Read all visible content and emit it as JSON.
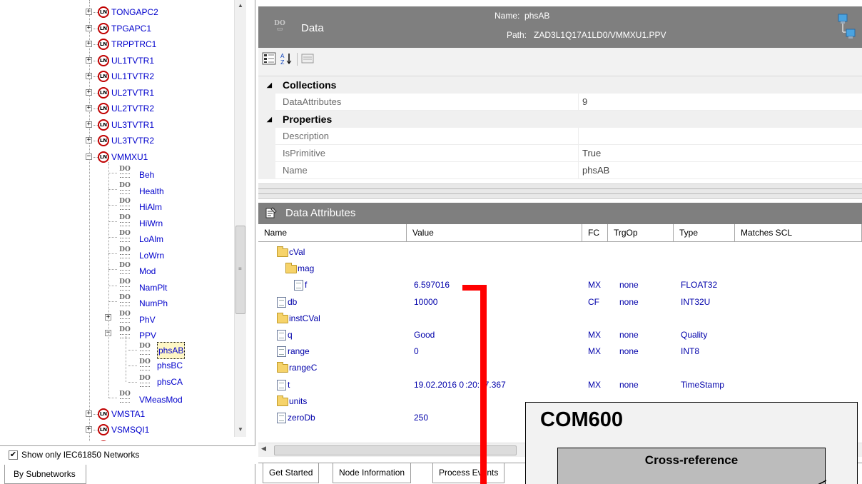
{
  "tree": {
    "ln_nodes_top": [
      "TONGAPC2",
      "TPGAPC1",
      "TRPPTRC1",
      "UL1TVTR1",
      "UL1TVTR2",
      "UL2TVTR1",
      "UL2TVTR2",
      "UL3TVTR1",
      "UL3TVTR2"
    ],
    "expanded_ln": "VMMXU1",
    "do_nodes": [
      "Beh",
      "Health",
      "HiAlm",
      "HiWrn",
      "LoAlm",
      "LoWrn",
      "Mod",
      "NamPlt",
      "NumPh",
      "PhV",
      "PPV"
    ],
    "ppv_children": [
      "phsAB",
      "phsBC",
      "phsCA"
    ],
    "selected": "phsAB",
    "after_do": "VMeasMod",
    "ln_nodes_bottom": [
      "VMSTA1",
      "VSMSQI1"
    ],
    "ln_icon_text": "LN",
    "do_icon_text": "DO"
  },
  "left_footer": {
    "show_only_checked": true,
    "show_only_label": "Show only IEC61850 Networks",
    "tab_label": "By Subnetworks"
  },
  "data_header": {
    "icon_text": "DO",
    "title": "Data",
    "name_label": "Name:",
    "name_value": "phsAB",
    "path_label": "Path:",
    "path_value": "ZAD3L1Q17A1LD0/VMMXU1.PPV"
  },
  "properties": {
    "categories": [
      {
        "label": "Collections",
        "rows": [
          {
            "key": "DataAttributes",
            "value": "9"
          }
        ]
      },
      {
        "label": "Properties",
        "rows": [
          {
            "key": "Description",
            "value": ""
          },
          {
            "key": "IsPrimitive",
            "value": "True"
          },
          {
            "key": "Name",
            "value": "phsAB"
          }
        ]
      }
    ]
  },
  "data_attributes": {
    "title": "Data Attributes",
    "columns": [
      "Name",
      "Value",
      "FC",
      "TrgOp",
      "Type",
      "Matches SCL"
    ],
    "rows": [
      {
        "icon": "folder",
        "indent": 0,
        "name": "cVal",
        "value": "",
        "fc": "",
        "trgop": "",
        "type": ""
      },
      {
        "icon": "folder",
        "indent": 1,
        "name": "mag",
        "value": "",
        "fc": "",
        "trgop": "",
        "type": ""
      },
      {
        "icon": "doc",
        "indent": 2,
        "name": "f",
        "value": "6.597016",
        "fc": "MX",
        "trgop": "none",
        "type": "FLOAT32"
      },
      {
        "icon": "doc",
        "indent": 0,
        "name": "db",
        "value": "10000",
        "fc": "CF",
        "trgop": "none",
        "type": "INT32U"
      },
      {
        "icon": "folder",
        "indent": 0,
        "name": "instCVal",
        "value": "",
        "fc": "",
        "trgop": "",
        "type": ""
      },
      {
        "icon": "doc",
        "indent": 0,
        "name": "q",
        "value": "Good",
        "fc": "MX",
        "trgop": "none",
        "type": "Quality"
      },
      {
        "icon": "doc",
        "indent": 0,
        "name": "range",
        "value": "0",
        "fc": "MX",
        "trgop": "none",
        "type": "INT8"
      },
      {
        "icon": "folder",
        "indent": 0,
        "name": "rangeC",
        "value": "",
        "fc": "",
        "trgop": "",
        "type": ""
      },
      {
        "icon": "doc",
        "indent": 0,
        "name": "t",
        "value": "19.02.2016 0 :20:17.367",
        "fc": "MX",
        "trgop": "none",
        "type": "TimeStamp"
      },
      {
        "icon": "folder",
        "indent": 0,
        "name": "units",
        "value": "",
        "fc": "",
        "trgop": "",
        "type": ""
      },
      {
        "icon": "doc",
        "indent": 0,
        "name": "zeroDb",
        "value": "250",
        "fc": "",
        "trgop": "",
        "type": ""
      }
    ]
  },
  "bottom_tabs": [
    "Get Started",
    "Node Information",
    "Process Events"
  ],
  "overlay": {
    "box_title": "COM600",
    "xref_label": "Cross-reference"
  },
  "colors": {
    "header_gray": "#7f7f7f",
    "tree_blue": "#0000cc",
    "ln_red": "#c00000",
    "highlight_red": "#ff0000",
    "xref_gray": "#bcbcbc"
  }
}
